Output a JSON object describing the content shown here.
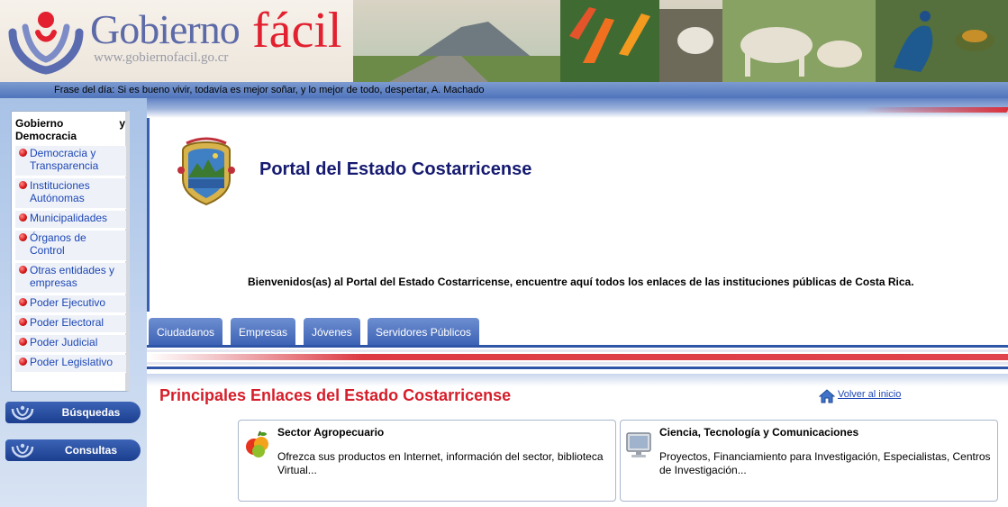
{
  "header": {
    "logo_gobierno": "Gobierno",
    "logo_facil": "fácil",
    "logo_url": "www.gobiernofacil.go.cr"
  },
  "phrase_bar": {
    "text": "Frase del día: Si es bueno vivir, todavía es mejor soñar, y lo mejor de todo, despertar, A. Machado"
  },
  "sidebar": {
    "title": "Gobierno Democracia",
    "title_suffix": "y",
    "items": [
      {
        "label": "Democracia y Transparencia"
      },
      {
        "label": "Instituciones Autónomas"
      },
      {
        "label": "Municipalidades"
      },
      {
        "label": "Órganos de Control"
      },
      {
        "label": "Otras entidades y empresas"
      },
      {
        "label": "Poder Ejecutivo"
      },
      {
        "label": "Poder Electoral"
      },
      {
        "label": "Poder Judicial"
      },
      {
        "label": "Poder Legislativo"
      }
    ],
    "buttons": [
      {
        "label": "Búsquedas"
      },
      {
        "label": "Consultas"
      }
    ]
  },
  "main": {
    "title": "Portal del Estado Costarricense",
    "welcome": "Bienvenidos(as) al Portal del Estado Costarricense, encuentre aquí todos los enlaces de las instituciones públicas de Costa Rica.",
    "tabs": [
      {
        "label": "Ciudadanos"
      },
      {
        "label": "Empresas"
      },
      {
        "label": "Jóvenes"
      },
      {
        "label": "Servidores Públicos"
      }
    ],
    "links_title": "Principales Enlaces del Estado Costarricense",
    "home_link": "Volver al inicio",
    "cards": [
      {
        "title": "Sector Agropecuario",
        "description": "Ofrezca sus productos en Internet, información del sector, biblioteca Virtual..."
      },
      {
        "title": "Ciencia, Tecnología y Comunicaciones",
        "description": "Proyectos, Financiamiento para Investigación, Especialistas, Centros de Investigación..."
      }
    ]
  },
  "colors": {
    "brand_blue": "#3e63b5",
    "brand_red": "#d51e2a",
    "link_blue": "#1d46b5",
    "title_navy": "#151a70"
  }
}
